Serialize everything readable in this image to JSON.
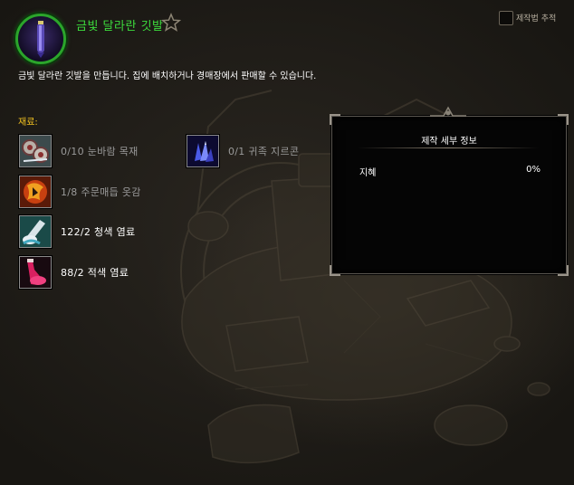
{
  "recipe": {
    "title": "금빛 달라란 깃발",
    "description": "금빛 달라란 깃발을 만듭니다. 집에 배치하거나 경매장에서 판매할 수 있습니다.",
    "title_color": "#3ddc3d",
    "icon": "purple-banner-icon"
  },
  "track": {
    "label": "제작법 추적",
    "checked": false
  },
  "reagents": {
    "label": "재료:",
    "items": [
      {
        "text": "0/10 눈바람 목재",
        "icon": "snowwind-lumber-icon",
        "sufficient": false
      },
      {
        "text": "0/1 귀족 지르콘",
        "icon": "noble-zircon-icon",
        "sufficient": false
      },
      {
        "text": "1/8 주문매듭 옷감",
        "icon": "spellknot-cloth-icon",
        "sufficient": false
      },
      {
        "text": "122/2 청색 염료",
        "icon": "blue-dye-icon",
        "sufficient": true
      },
      {
        "text": "88/2 적색 염료",
        "icon": "red-dye-icon",
        "sufficient": true
      }
    ]
  },
  "details": {
    "title": "제작 세부 정보",
    "stat_name": "지혜",
    "stat_value": "0%"
  }
}
